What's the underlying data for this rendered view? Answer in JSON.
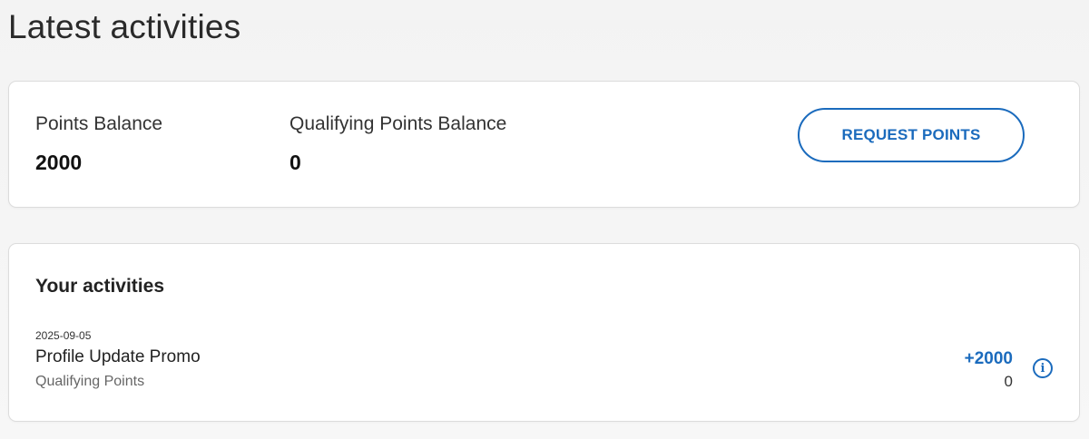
{
  "page": {
    "title": "Latest activities"
  },
  "balances": {
    "points_label": "Points Balance",
    "points_value": "2000",
    "qualifying_label": "Qualifying Points Balance",
    "qualifying_value": "0",
    "request_button_label": "REQUEST POINTS"
  },
  "activities": {
    "heading": "Your activities",
    "items": [
      {
        "date": "2025-09-05",
        "name": "Profile Update Promo",
        "category": "Qualifying Points",
        "points": "+2000",
        "qualifying_points": "0",
        "info_icon": "info-icon"
      }
    ]
  },
  "colors": {
    "accent": "#1b6bbd",
    "background": "#f5f5f5",
    "card": "#ffffff",
    "border": "#dcdcdc"
  },
  "icons": {
    "info_glyph": "i"
  }
}
